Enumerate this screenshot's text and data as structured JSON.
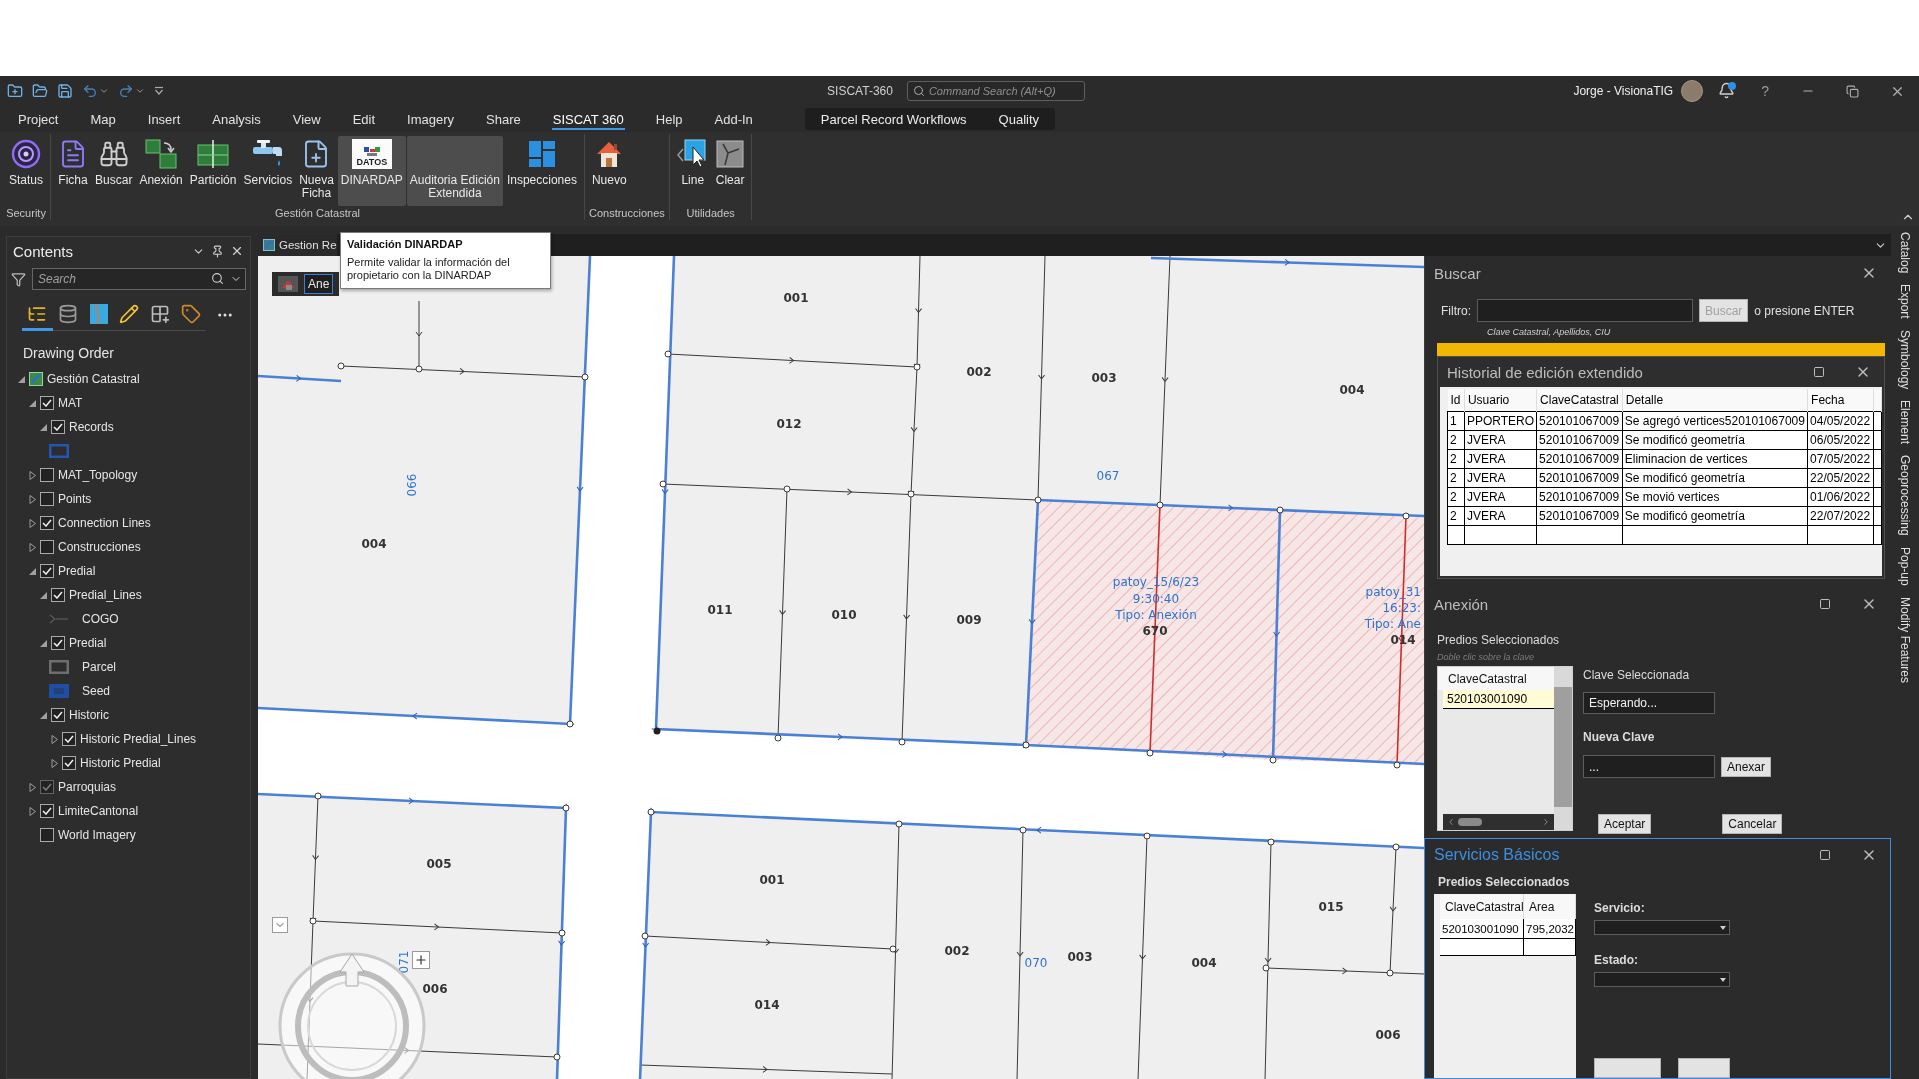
{
  "app": {
    "title": "SISCAT-360",
    "command_search": {
      "placeholder": "Command Search (Alt+Q)"
    },
    "user": "Jorge - VisionaTIG",
    "help": "?"
  },
  "menu_tabs": [
    {
      "label": "Project",
      "selected": false
    },
    {
      "label": "Map",
      "selected": false
    },
    {
      "label": "Insert",
      "selected": false
    },
    {
      "label": "Analysis",
      "selected": false
    },
    {
      "label": "View",
      "selected": false
    },
    {
      "label": "Edit",
      "selected": false
    },
    {
      "label": "Imagery",
      "selected": false
    },
    {
      "label": "Share",
      "selected": false
    },
    {
      "label": "SISCAT 360",
      "selected": true
    },
    {
      "label": "Help",
      "selected": false
    },
    {
      "label": "Add-In",
      "selected": false
    }
  ],
  "contextual_tabs": [
    "Parcel Record Workflows",
    "Quality"
  ],
  "ribbon": {
    "groups": [
      {
        "label": "Security",
        "buttons": [
          {
            "label": "Status",
            "kind": "status",
            "highlighted": false
          }
        ]
      },
      {
        "label": "Gestión Catastral",
        "buttons": [
          {
            "label": "Ficha",
            "kind": "document",
            "highlighted": false
          },
          {
            "label": "Buscar",
            "kind": "binoculars",
            "highlighted": false
          },
          {
            "label": "Anexión",
            "kind": "merge",
            "highlighted": false
          },
          {
            "label": "Partición",
            "kind": "split",
            "highlighted": false
          },
          {
            "label": "Servicios",
            "kind": "faucet",
            "highlighted": false
          },
          {
            "label": "Nueva\nFicha",
            "kind": "new-document",
            "highlighted": false
          },
          {
            "label": "DINARDAP",
            "kind": "logo",
            "logo_text": "DATOS",
            "highlighted": true
          },
          {
            "label": "Auditoria Edición\nExtendida",
            "kind": "blank",
            "highlighted": true
          },
          {
            "label": "Inspecciones",
            "kind": "tiles",
            "highlighted": false
          }
        ]
      },
      {
        "label": "Construcciones",
        "buttons": [
          {
            "label": "Nuevo",
            "kind": "house",
            "highlighted": false
          }
        ]
      },
      {
        "label": "Utilidades",
        "buttons": [
          {
            "label": "Line",
            "kind": "pointer",
            "highlighted": false
          },
          {
            "label": "Clear",
            "kind": "eraser",
            "highlighted": false
          }
        ]
      }
    ]
  },
  "contents": {
    "title": "Contents",
    "search": {
      "placeholder": "Search"
    },
    "view_tabs": [
      {
        "kind": "tree",
        "selected": true
      },
      {
        "kind": "database",
        "selected": false
      },
      {
        "kind": "map",
        "selected": false
      },
      {
        "kind": "pencil",
        "selected": false
      },
      {
        "kind": "grid",
        "selected": false
      },
      {
        "kind": "tag",
        "selected": false
      }
    ],
    "heading": "Drawing Order",
    "tree": [
      {
        "kind": "map",
        "label": "Gestión Catastral",
        "expanded": true,
        "children": [
          {
            "kind": "layer",
            "label": "MAT",
            "checked": true,
            "disabled": false,
            "expanded": true,
            "children": [
              {
                "kind": "layer",
                "label": "Records",
                "checked": true,
                "disabled": false,
                "expanded": true,
                "children": [
                  {
                    "kind": "outline",
                    "color": "#2456b4"
                  }
                ]
              }
            ]
          },
          {
            "kind": "layer",
            "label": "MAT_Topology",
            "checked": false,
            "disabled": false,
            "expanded": false
          },
          {
            "kind": "layer",
            "label": "Points",
            "checked": false,
            "disabled": false,
            "expanded": false
          },
          {
            "kind": "layer",
            "label": "Connection Lines",
            "checked": true,
            "disabled": false,
            "expanded": false
          },
          {
            "kind": "layer",
            "label": "Construcciones",
            "checked": false,
            "disabled": false,
            "expanded": false
          },
          {
            "kind": "layer",
            "label": "Predial",
            "checked": true,
            "disabled": false,
            "expanded": true,
            "children": [
              {
                "kind": "layer",
                "label": "Predial_Lines",
                "checked": true,
                "disabled": false,
                "expanded": true,
                "children": [
                  {
                    "kind": "line",
                    "label": "COGO",
                    "color": "#5c5c5c"
                  }
                ]
              },
              {
                "kind": "layer",
                "label": "Predial",
                "checked": true,
                "disabled": false,
                "expanded": true,
                "children": [
                  {
                    "kind": "outline",
                    "label": "Parcel",
                    "color": "#6e6e6e"
                  },
                  {
                    "kind": "fill",
                    "label": "Seed",
                    "color": "#1f4fa3"
                  }
                ]
              },
              {
                "kind": "layer",
                "label": "Historic",
                "checked": true,
                "disabled": false,
                "expanded": true,
                "children": [
                  {
                    "kind": "layer",
                    "label": "Historic Predial_Lines",
                    "checked": true,
                    "disabled": false,
                    "expanded": false
                  },
                  {
                    "kind": "layer",
                    "label": "Historic Predial",
                    "checked": true,
                    "disabled": false,
                    "expanded": false
                  }
                ]
              }
            ]
          },
          {
            "kind": "layer",
            "label": "Parroquias",
            "checked": true,
            "disabled": true,
            "expanded": false
          },
          {
            "kind": "layer",
            "label": "LimiteCantonal",
            "checked": true,
            "disabled": false,
            "expanded": false
          },
          {
            "kind": "basemap",
            "label": "World Imagery",
            "checked": false,
            "disabled": false
          }
        ]
      }
    ]
  },
  "map_view": {
    "tab": "Gestion Re",
    "tool_field": "Ane",
    "tooltip": {
      "title": "Validación DINARDAP",
      "text": "Permite validar la información del propietario con la DINARDAP"
    },
    "labels": [
      {
        "text": "001",
        "kind": "parcel"
      },
      {
        "text": "002",
        "kind": "parcel"
      },
      {
        "text": "003",
        "kind": "parcel"
      },
      {
        "text": "004",
        "kind": "parcel"
      },
      {
        "text": "012",
        "kind": "parcel"
      },
      {
        "text": "067",
        "kind": "block"
      },
      {
        "text": "066",
        "kind": "block"
      },
      {
        "text": "004",
        "kind": "parcel"
      },
      {
        "text": "patoy_15/6/23",
        "kind": "annotation"
      },
      {
        "text": "9:30:40",
        "kind": "annotation"
      },
      {
        "text": "Tipo: Anexión",
        "kind": "annotation"
      },
      {
        "text": "670",
        "kind": "parcel"
      },
      {
        "text": "patoy_31",
        "kind": "annotation"
      },
      {
        "text": "16:23:",
        "kind": "annotation"
      },
      {
        "text": "Tipo: Ane",
        "kind": "annotation"
      },
      {
        "text": "014",
        "kind": "parcel"
      },
      {
        "text": "011",
        "kind": "parcel"
      },
      {
        "text": "010",
        "kind": "parcel"
      },
      {
        "text": "009",
        "kind": "parcel"
      },
      {
        "text": "005",
        "kind": "parcel"
      },
      {
        "text": "001",
        "kind": "parcel"
      },
      {
        "text": "015",
        "kind": "parcel"
      },
      {
        "text": "002",
        "kind": "parcel"
      },
      {
        "text": "070",
        "kind": "block"
      },
      {
        "text": "003",
        "kind": "parcel"
      },
      {
        "text": "004",
        "kind": "parcel"
      },
      {
        "text": "071",
        "kind": "block"
      },
      {
        "text": "006",
        "kind": "parcel"
      },
      {
        "text": "014",
        "kind": "parcel"
      },
      {
        "text": "006",
        "kind": "parcel"
      }
    ]
  },
  "buscar": {
    "title": "Buscar",
    "filter_label": "Filtro:",
    "button": {
      "label": "Buscar",
      "disabled": true
    },
    "enter_hint": "o presione ENTER",
    "hint": "Clave Catastral, Apellidos, CIU"
  },
  "historial": {
    "title": "Historial de edición extendido",
    "columns": [
      "Id",
      "Usuario",
      "ClaveCatastral",
      "Detalle",
      "Fecha"
    ],
    "rows": [
      [
        "1",
        "PPORTERO",
        "520101067009",
        "Se agregó vertices520101067009",
        "04/05/2022"
      ],
      [
        "2",
        "JVERA",
        "520101067009",
        "Se modificó geometría",
        "06/05/2022"
      ],
      [
        "2",
        "JVERA",
        "520101067009",
        "Eliminacion de vertices",
        "07/05/2022"
      ],
      [
        "2",
        "JVERA",
        "520101067009",
        "Se modificó geometría",
        "22/05/2022"
      ],
      [
        "2",
        "JVERA",
        "520101067009",
        "Se movió vertices",
        "01/06/2022"
      ],
      [
        "2",
        "JVERA",
        "520101067009",
        "Se modificó geometría",
        "22/07/2022"
      ]
    ]
  },
  "anexion": {
    "title": "Anexión",
    "list_title": "Predios Seleccionados",
    "list_hint": "Doble clic sobre la clave",
    "list": {
      "column": "ClaveCatastral",
      "rows": [
        {
          "value": "520103001090",
          "selected": true
        }
      ]
    },
    "selected_label": "Clave Seleccionada",
    "selected_value": "Esperando...",
    "new_label": "Nueva Clave",
    "new_value": "...",
    "annex_button": "Anexar",
    "buttons": [
      "Aceptar",
      "Cancelar"
    ]
  },
  "servicios": {
    "title": "Servicios Básicos",
    "active": true,
    "list_title": "Predios Seleccionados",
    "table": {
      "columns": [
        "ClaveCatastral",
        "Area"
      ],
      "rows": [
        [
          "520103001090",
          "795,2032"
        ]
      ]
    },
    "fields": [
      {
        "label": "Servicio:"
      },
      {
        "label": "Estado:"
      }
    ]
  },
  "side_tabs": [
    "Catalog",
    "Export",
    "Symbology",
    "Element",
    "Geoprocessing",
    "Pop-up",
    "Modify Features"
  ]
}
